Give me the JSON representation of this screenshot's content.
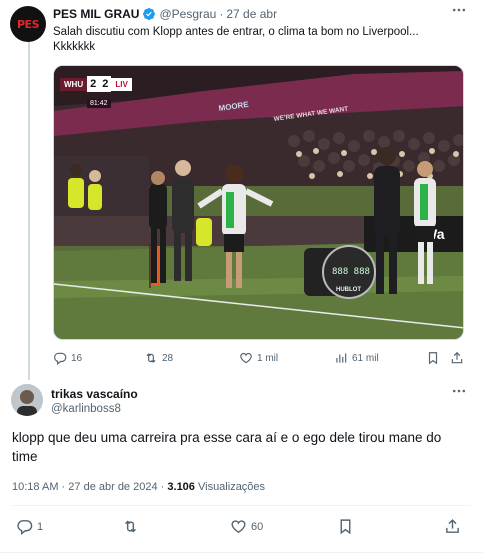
{
  "tweet": {
    "author_name": "PES MIL GRAU",
    "author_handle": "@Pesgrau",
    "separator": "·",
    "date": "27 de abr",
    "avatar_text": "PES",
    "text": "Salah discutiu com Klopp antes de entrar, o clima ta bom no Liverpool... Kkkkkkk",
    "more_icon": "more-icon",
    "media": {
      "scoreboard": {
        "home": "WHU",
        "home_goals": "2",
        "away_goals": "2",
        "away": "LIV",
        "clock": "81:42"
      },
      "ad_boards": [
        "MOORE",
        "WE'RE WHAT WE WANT",
        "HUBLOT"
      ]
    },
    "stats": {
      "replies": "16",
      "retweets": "28",
      "likes": "1 mil",
      "views": "61 mil"
    }
  },
  "reply": {
    "author_name": "trikas vascaíno",
    "author_handle": "@karlinboss8",
    "text": "klopp que deu uma carreira pra esse cara aí e o ego dele tirou mane do time",
    "time": "10:18 AM",
    "separator": "·",
    "date": "27 de abr de 2024",
    "views_count": "3.106",
    "views_label": "Visualizações",
    "stats": {
      "replies": "1",
      "retweets": "",
      "likes": "60"
    }
  },
  "colors": {
    "accent": "#1d9bf0",
    "text": "#0f1419",
    "secondary": "#536471",
    "border": "#cfd9de"
  }
}
